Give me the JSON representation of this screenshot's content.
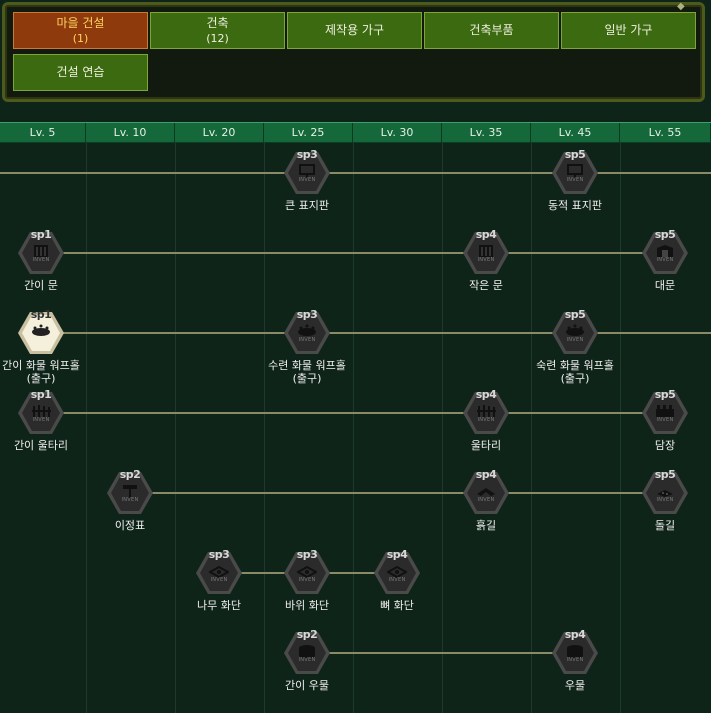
{
  "categories": [
    {
      "label": "마을 건설",
      "count": "(1)",
      "active": true
    },
    {
      "label": "건축",
      "count": "(12)",
      "active": false
    },
    {
      "label": "제작용 가구",
      "count": "",
      "active": false
    },
    {
      "label": "건축부품",
      "count": "",
      "active": false
    },
    {
      "label": "일반 가구",
      "count": "",
      "active": false
    },
    {
      "label": "건설 연습",
      "count": "",
      "active": false
    }
  ],
  "levels": [
    "Lv. 5",
    "Lv. 10",
    "Lv. 20",
    "Lv. 25",
    "Lv. 30",
    "Lv. 35",
    "Lv. 45",
    "Lv. 55"
  ],
  "skills": [
    {
      "sp": "sp3",
      "name": "큰 표지판",
      "sub": "",
      "inv": "INVEN",
      "icon": "signboard-icon"
    },
    {
      "sp": "sp5",
      "name": "동적 표지판",
      "sub": "",
      "inv": "INVEN",
      "icon": "signboard-icon"
    },
    {
      "sp": "sp1",
      "name": "간이 문",
      "sub": "",
      "inv": "INVEN",
      "icon": "door-icon"
    },
    {
      "sp": "sp4",
      "name": "작은 문",
      "sub": "",
      "inv": "INVEN",
      "icon": "door-icon"
    },
    {
      "sp": "sp5",
      "name": "대문",
      "sub": "",
      "inv": "INVEN",
      "icon": "gate-icon"
    },
    {
      "sp": "sp1",
      "name": "간이 화물 워프홀",
      "sub": "(출구)",
      "inv": "",
      "icon": "warp-hole-icon"
    },
    {
      "sp": "sp3",
      "name": "수련 화물 워프홀",
      "sub": "(출구)",
      "inv": "INVEN",
      "icon": "warp-hole-icon"
    },
    {
      "sp": "sp5",
      "name": "숙련 화물 워프홀",
      "sub": "(출구)",
      "inv": "INVEN",
      "icon": "warp-hole-icon"
    },
    {
      "sp": "sp1",
      "name": "간이 울타리",
      "sub": "",
      "inv": "INVEN",
      "icon": "fence-icon"
    },
    {
      "sp": "sp4",
      "name": "울타리",
      "sub": "",
      "inv": "INVEN",
      "icon": "fence-icon"
    },
    {
      "sp": "sp5",
      "name": "담장",
      "sub": "",
      "inv": "INVEN",
      "icon": "wall-icon"
    },
    {
      "sp": "sp2",
      "name": "이정표",
      "sub": "",
      "inv": "INVEN",
      "icon": "milestone-icon"
    },
    {
      "sp": "sp4",
      "name": "흙길",
      "sub": "",
      "inv": "INVEN",
      "icon": "dirt-road-icon"
    },
    {
      "sp": "sp5",
      "name": "돌길",
      "sub": "",
      "inv": "INVEN",
      "icon": "stone-road-icon"
    },
    {
      "sp": "sp3",
      "name": "나무 화단",
      "sub": "",
      "inv": "INVEN",
      "icon": "flowerbed-icon"
    },
    {
      "sp": "sp3",
      "name": "바위 화단",
      "sub": "",
      "inv": "INVEN",
      "icon": "flowerbed-icon"
    },
    {
      "sp": "sp4",
      "name": "뼈 화단",
      "sub": "",
      "inv": "INVEN",
      "icon": "flowerbed-icon"
    },
    {
      "sp": "sp2",
      "name": "간이 우물",
      "sub": "",
      "inv": "INVEN",
      "icon": "well-icon"
    },
    {
      "sp": "sp4",
      "name": "우물",
      "sub": "",
      "inv": "INVEN",
      "icon": "well-icon"
    }
  ],
  "colors": {
    "accent_active": "#8e3a0c",
    "button": "#3b6a10",
    "header": "#14683a",
    "learned_node": "#f4f0dc"
  }
}
